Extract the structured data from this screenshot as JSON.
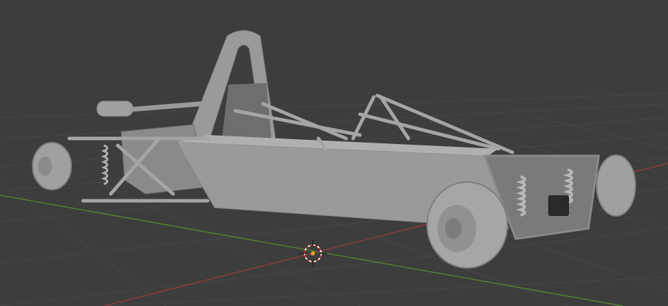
{
  "viewport": {
    "background_color": "#3d3d3d",
    "grid_color": "#474747",
    "x_axis_color": "#9c3a3a",
    "y_axis_color": "#5a8a2a",
    "model_color": "#9a9a9a",
    "model_shadow_color": "#6e6e6e",
    "model_highlight_color": "#b4b4b4",
    "cursor_icon": "3d-cursor-icon",
    "object_origin_icon": "origin-dot-icon"
  }
}
